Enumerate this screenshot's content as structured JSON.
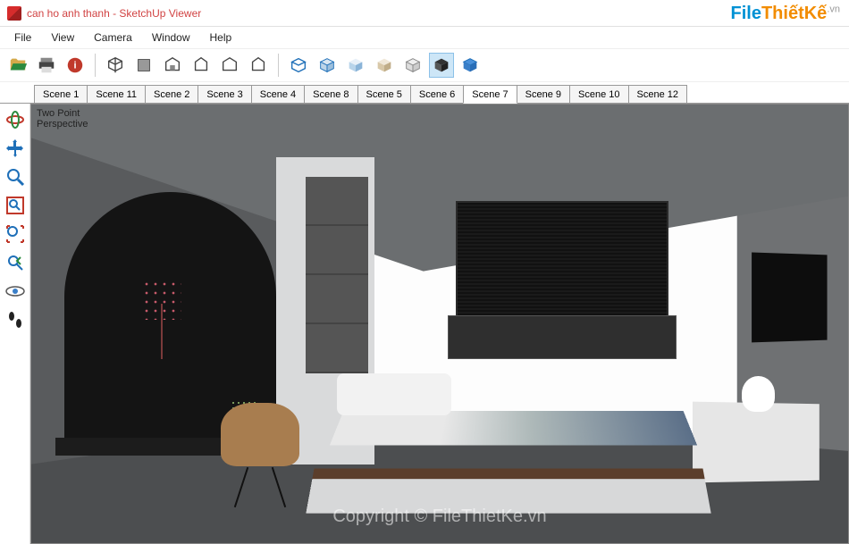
{
  "window": {
    "title": "can ho anh thanh - SketchUp Viewer"
  },
  "watermark": {
    "brand_a": "File",
    "brand_b": "ThiếtKế",
    "tld": ".vn",
    "copyright": "Copyright © FileThietKe.vn"
  },
  "menu": {
    "items": [
      "File",
      "View",
      "Camera",
      "Window",
      "Help"
    ]
  },
  "toolbar_groups": {
    "file": [
      "open",
      "print",
      "report"
    ],
    "view": [
      "iso",
      "top",
      "front",
      "right",
      "back",
      "left"
    ],
    "style": [
      "wireframe",
      "hidden",
      "shaded",
      "shaded-tex",
      "mono",
      "xray",
      "back-edges"
    ]
  },
  "scene_tabs": {
    "items": [
      "Scene 1",
      "Scene 11",
      "Scene 2",
      "Scene 3",
      "Scene 4",
      "Scene 8",
      "Scene 5",
      "Scene 6",
      "Scene 7",
      "Scene 9",
      "Scene 10",
      "Scene 12"
    ],
    "active_index": 8
  },
  "side_tools": [
    "orbit",
    "pan",
    "zoom",
    "zoom-window",
    "zoom-extents",
    "prev-view",
    "look-around",
    "walk"
  ],
  "viewport": {
    "camera_label": "Two Point\nPerspective"
  }
}
